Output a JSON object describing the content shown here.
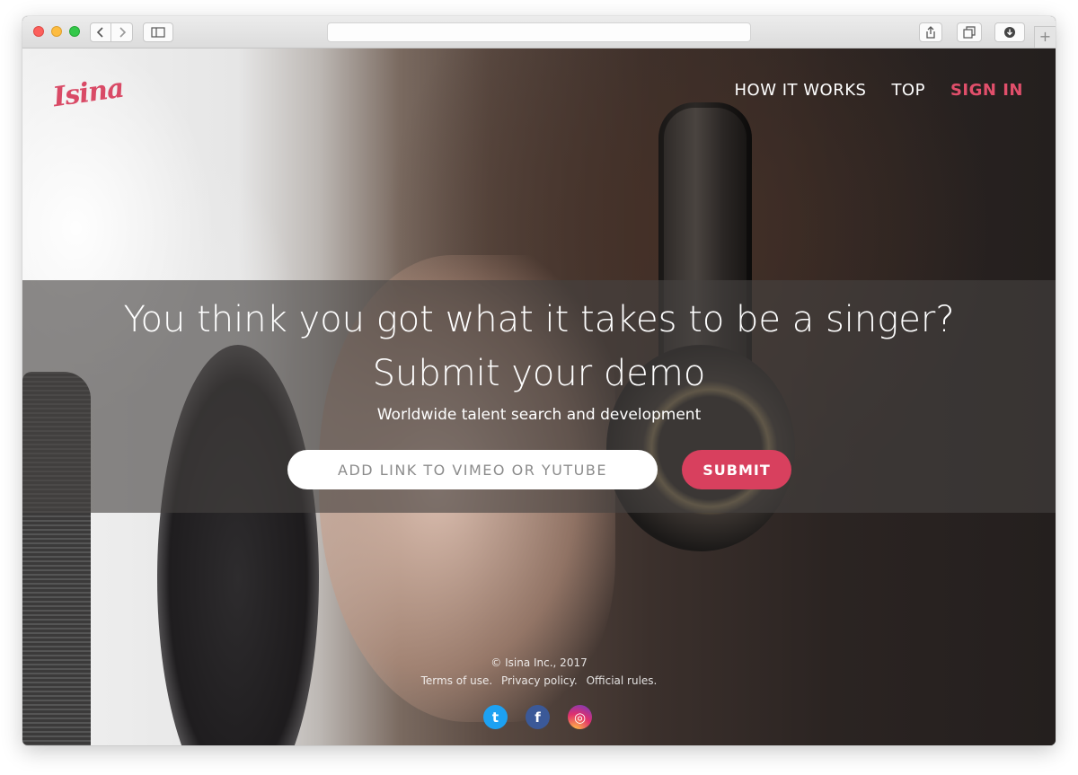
{
  "browser": {
    "address": "",
    "new_tab_label": "+"
  },
  "header": {
    "logo_text": "Isina",
    "nav": [
      {
        "label": "HOW IT WORKS"
      },
      {
        "label": "TOP"
      },
      {
        "label": "SIGN IN"
      }
    ]
  },
  "hero": {
    "title_line1": "You think you got what it takes to be a singer?",
    "title_line2": "Submit your demo",
    "subtitle": "Worldwide talent search and development",
    "input_placeholder": "ADD LINK TO VIMEO OR YUTUBE",
    "submit_label": "SUBMIT"
  },
  "footer": {
    "copyright": "© Isina Inc., 2017",
    "links": [
      {
        "label": "Terms of use."
      },
      {
        "label": "Privacy policy."
      },
      {
        "label": "Official rules."
      }
    ],
    "social": [
      {
        "icon": "twitter-icon",
        "glyph": "t"
      },
      {
        "icon": "facebook-icon",
        "glyph": "f"
      },
      {
        "icon": "instagram-icon",
        "glyph": "◎"
      }
    ]
  },
  "colors": {
    "accent": "#d8405e",
    "sign_in": "#e14f6b"
  }
}
